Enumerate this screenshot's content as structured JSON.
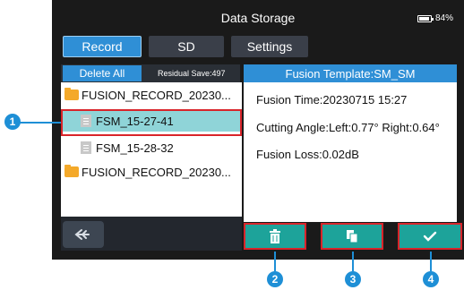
{
  "header": {
    "title": "Data Storage",
    "battery": "84%"
  },
  "tabs": [
    {
      "label": "Record",
      "active": true
    },
    {
      "label": "SD",
      "active": false
    },
    {
      "label": "Settings",
      "active": false
    }
  ],
  "left": {
    "delete_all": "Delete All",
    "residual": "Residual Save:497",
    "items": [
      {
        "type": "folder",
        "label": "FUSION_RECORD_20230..."
      },
      {
        "type": "file",
        "label": "FSM_15-27-41",
        "selected": true
      },
      {
        "type": "file",
        "label": "FSM_15-28-32"
      },
      {
        "type": "folder",
        "label": "FUSION_RECORD_20230..."
      }
    ]
  },
  "right": {
    "header": "Fusion Template:SM_SM",
    "details": [
      "Fusion Time:20230715 15:27",
      "Cutting Angle:Left:0.77° Right:0.64°",
      "Fusion Loss:0.02dB"
    ]
  },
  "actions": {
    "delete": "trash-icon",
    "copy": "copy-icon",
    "confirm": "check-icon"
  },
  "callouts": [
    "1",
    "2",
    "3",
    "4"
  ],
  "colors": {
    "accent": "#2f8fd6",
    "action": "#1da39a",
    "highlight": "#d9242a",
    "selected_row": "#8fd4d8",
    "callout": "#1e8fd6"
  }
}
